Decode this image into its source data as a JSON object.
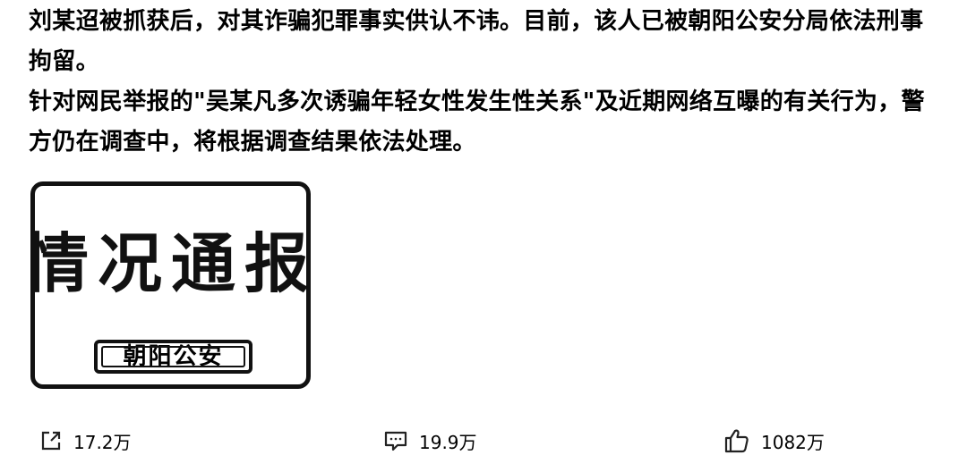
{
  "article": {
    "paragraph_1": "刘某迢被抓获后，对其诈骗犯罪事实供认不讳。目前，该人已被朝阳公安分局依法刑事拘留。",
    "paragraph_2": "针对网民举报的\"吴某凡多次诱骗年轻女性发生性关系\"及近期网络互曝的有关行为，警方仍在调查中，将根据调查结果依法处理。"
  },
  "image_card": {
    "title": "情况通报",
    "badge": "朝阳公安"
  },
  "actions": {
    "share": {
      "icon": "share-icon",
      "count": "17.2万"
    },
    "comment": {
      "icon": "comment-icon",
      "count": "19.9万"
    },
    "like": {
      "icon": "thumbs-up-icon",
      "count": "1082万"
    }
  }
}
